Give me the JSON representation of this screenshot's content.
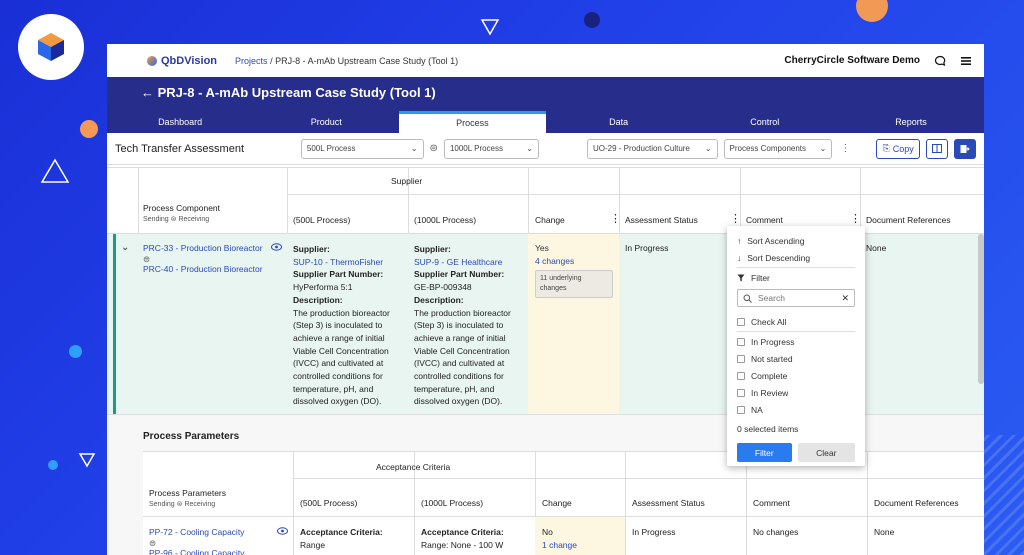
{
  "brand": {
    "name": "QbDVision"
  },
  "breadcrumb": {
    "projects": "Projects",
    "separator": "/",
    "current": "PRJ-8 - A-mAb Upstream Case Study (Tool 1)"
  },
  "account": {
    "company": "CherryCircle Software Demo"
  },
  "header": {
    "back": "←",
    "title": "PRJ-8 - A-mAb Upstream Case Study (Tool 1)"
  },
  "tabs": [
    {
      "label": "Dashboard"
    },
    {
      "label": "Product"
    },
    {
      "label": "Process"
    },
    {
      "label": "Data"
    },
    {
      "label": "Control"
    },
    {
      "label": "Reports"
    }
  ],
  "toolbar": {
    "title": "Tech Transfer Assessment",
    "sending": "500L Process",
    "receiving": "1000L Process",
    "unit_op": "UO-29 - Production Culture",
    "type": "Process Components",
    "copy": "Copy"
  },
  "components_table": {
    "supplier_group": "Supplier",
    "col_component": "Process Component",
    "col_component_sub": "Sending ⊜ Receiving",
    "col_sending": "(500L Process)",
    "col_receiving": "(1000L Process)",
    "col_change": "Change",
    "col_status": "Assessment Status",
    "col_comment": "Comment",
    "col_docs": "Document References",
    "row": {
      "expand": "⌄",
      "sending_id": "PRC-33 - Production Bioreactor",
      "link_icon": "⊜",
      "receiving_id": "PRC-40 - Production Bioreactor",
      "supplier_label": "Supplier:",
      "sending_supplier": "SUP-10 - ThermoFisher",
      "receiving_supplier": "SUP-9 - GE Healthcare",
      "part_label": "Supplier Part Number:",
      "sending_part": "HyPerforma 5:1",
      "receiving_part": "GE-BP-009348",
      "desc_label": "Description:",
      "sending_desc": [
        "The production bioreactor",
        "(Step 3) is inoculated to",
        "achieve a range of initial",
        "Viable Cell Concentration",
        "(IVCC) and cultivated at",
        "controlled conditions for",
        "temperature, pH, and",
        "dissolved oxygen (DO)."
      ],
      "receiving_desc": [
        "The production bioreactor",
        "(Step 3) is inoculated to",
        "achieve a range of initial",
        "Viable Cell Concentration",
        "(IVCC) and cultivated at",
        "controlled conditions for",
        "temperature, pH, and",
        "dissolved oxygen (DO)."
      ],
      "change_yes": "Yes",
      "change_count": "4 changes",
      "underlying": [
        "11 underlying",
        "changes"
      ],
      "status": "In Progress",
      "docs": "None"
    }
  },
  "filter_menu": {
    "sort_asc": "Sort Ascending",
    "sort_desc": "Sort Descending",
    "filter_title": "Filter",
    "search_placeholder": "Search",
    "options": [
      "Check All",
      "In Progress",
      "Not started",
      "Complete",
      "In Review",
      "NA"
    ],
    "selected": "0 selected items",
    "apply": "Filter",
    "clear": "Clear"
  },
  "params_section": {
    "title": "Process Parameters",
    "group": "Acceptance Criteria",
    "col_param": "Process Parameters",
    "col_param_sub": "Sending ⊜ Receiving",
    "col_sending": "(500L Process)",
    "col_receiving": "(1000L Process)",
    "col_change": "Change",
    "col_status": "Assessment Status",
    "col_comment": "Comment",
    "col_docs": "Document References",
    "row": {
      "sending_id": "PP-72 - Cooling Capacity",
      "link_icon": "⊜",
      "receiving_id": "PP-96 - Cooling Capacity",
      "ac_label": "Acceptance Criteria:",
      "sending_val": "Range",
      "receiving_val": "Range: None - 100 W",
      "change": "No",
      "change_count": "1 change",
      "status": "In Progress",
      "comment": "No changes",
      "docs": "None"
    }
  }
}
